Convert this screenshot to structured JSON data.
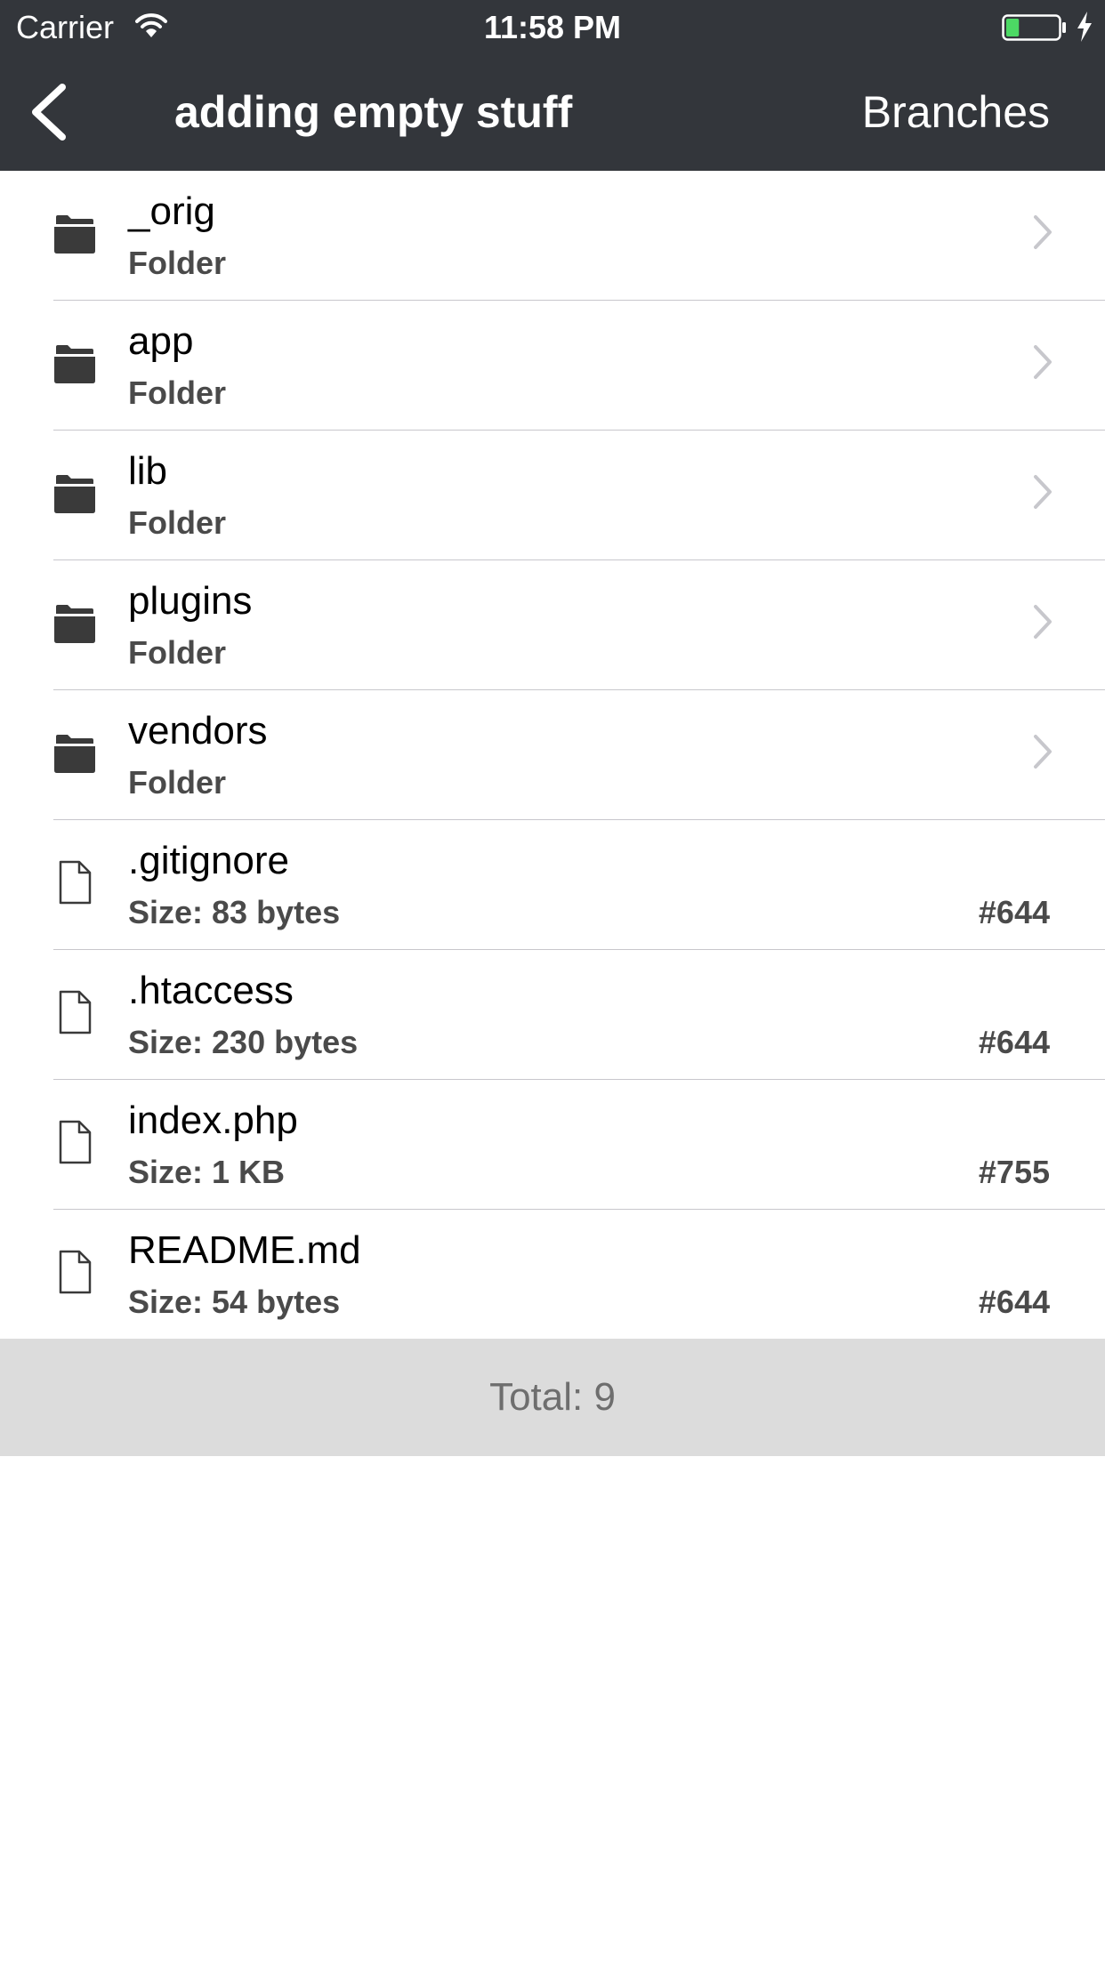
{
  "status_bar": {
    "carrier": "Carrier",
    "time": "11:58 PM",
    "battery_level": 0.25,
    "battery_color": "#4cd964"
  },
  "nav": {
    "back_icon": "chevron-left-icon",
    "title": "adding empty stuff",
    "right_button": "Branches"
  },
  "items": [
    {
      "type": "folder",
      "icon": "folder-icon",
      "name": "_orig",
      "subtitle": "Folder",
      "mode": ""
    },
    {
      "type": "folder",
      "icon": "folder-icon",
      "name": "app",
      "subtitle": "Folder",
      "mode": ""
    },
    {
      "type": "folder",
      "icon": "folder-icon",
      "name": "lib",
      "subtitle": "Folder",
      "mode": ""
    },
    {
      "type": "folder",
      "icon": "folder-icon",
      "name": "plugins",
      "subtitle": "Folder",
      "mode": ""
    },
    {
      "type": "folder",
      "icon": "folder-icon",
      "name": "vendors",
      "subtitle": "Folder",
      "mode": ""
    },
    {
      "type": "file",
      "icon": "file-icon",
      "name": ".gitignore",
      "subtitle": "Size: 83 bytes",
      "mode": "#644"
    },
    {
      "type": "file",
      "icon": "file-icon",
      "name": ".htaccess",
      "subtitle": "Size: 230 bytes",
      "mode": "#644"
    },
    {
      "type": "file",
      "icon": "file-icon",
      "name": "index.php",
      "subtitle": "Size: 1 KB",
      "mode": "#755"
    },
    {
      "type": "file",
      "icon": "file-icon",
      "name": "README.md",
      "subtitle": "Size: 54 bytes",
      "mode": "#644"
    }
  ],
  "footer": {
    "total": "Total: 9"
  },
  "colors": {
    "bar_background": "#33363b",
    "footer_background": "#dcdcdc",
    "icon": "#3a3a3a",
    "chevron": "#c7c7cc"
  }
}
